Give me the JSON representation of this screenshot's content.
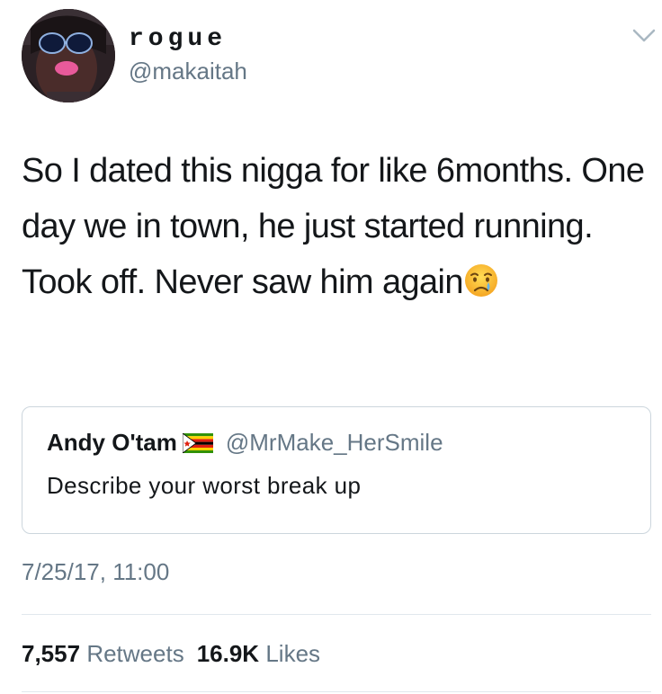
{
  "author": {
    "display_name": "rogue",
    "handle": "@makaitah"
  },
  "tweet": {
    "text": "So I dated this nigga for like 6months. One day we in town, he just started running. Took off. Never saw him again",
    "emoji": "crying-face"
  },
  "quoted_tweet": {
    "name": "Andy O'tam",
    "flag": "zimbabwe-flag",
    "handle": "@MrMake_HerSmile",
    "text": "Describe your worst break up"
  },
  "timestamp": "7/25/17, 11:00",
  "stats": {
    "retweets_count": "7,557",
    "retweets_label": "Retweets",
    "likes_count": "16.9K",
    "likes_label": "Likes"
  },
  "colors": {
    "text_primary": "#14171a",
    "text_secondary": "#657786",
    "border": "#ccd6dd",
    "divider": "#e1e8ed"
  }
}
